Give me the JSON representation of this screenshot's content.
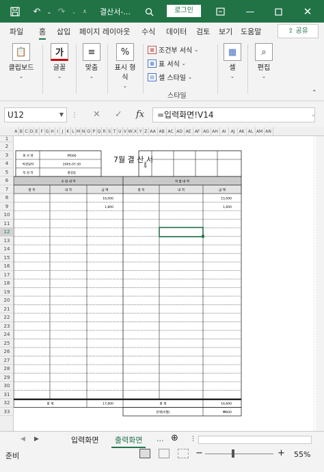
{
  "window": {
    "title": "결산서-...",
    "login_label": "로그인"
  },
  "ribbon_tabs": [
    "파일",
    "홈",
    "삽입",
    "페이지 레이아웃",
    "수식",
    "데이터",
    "검토",
    "보기",
    "도움말"
  ],
  "share_label": "공유",
  "ribbon": {
    "clipboard": "클립보드",
    "font": "글꼴",
    "align": "맞춤",
    "number_line1": "표시 형",
    "number_line2": "식",
    "conditional": "조건부 서식",
    "table_format": "표 서식",
    "cell_style": "셀 스타일",
    "style_group": "스타일",
    "cells": "셀",
    "editing": "편집"
  },
  "formula": {
    "cell_ref": "U12",
    "fx": "fx",
    "value": "=입력화면!V14"
  },
  "columns": [
    "A",
    "B",
    "C",
    "D",
    "E",
    "F",
    "G",
    "H",
    "I",
    "J",
    "K",
    "L",
    "M",
    "N",
    "O",
    "P",
    "Q",
    "R",
    "S",
    "T",
    "U",
    "V",
    "W",
    "X",
    "Y",
    "Z",
    "AA",
    "AB",
    "AC",
    "AD",
    "AE",
    "AF",
    "AG",
    "AH",
    "AI",
    "AJ",
    "AK",
    "AL",
    "AM",
    "AN"
  ],
  "rows": [
    "1",
    "2",
    "3",
    "4",
    "5",
    "6",
    "7",
    "8",
    "9",
    "10",
    "11",
    "12",
    "13",
    "14",
    "15",
    "16",
    "17",
    "18",
    "19",
    "20",
    "21",
    "22",
    "23",
    "24",
    "25",
    "26",
    "27",
    "28",
    "29",
    "30",
    "31",
    "32",
    "33"
  ],
  "report": {
    "title": "7월   결 산 서",
    "company_label": "회 사 명",
    "company_value": "㈜000",
    "date_label": "작성일자",
    "date_value": "2005-07-30",
    "author_label": "작 성 자",
    "author_value": "홍길동",
    "approval_label": "결재",
    "income_header": "수 입 내 역",
    "expense_header": "지 출 내 역",
    "col_item": "항 목",
    "col_detail": "내 역",
    "col_amount": "금 액",
    "income_amounts": [
      "16,000",
      "1,800"
    ],
    "expense_amounts": [
      "15,000",
      "1,600"
    ],
    "total_label": "합 계",
    "income_total": "17,800",
    "expense_total": "16,600",
    "balance_label": "잔액(이월)",
    "balance_value": "₩600"
  },
  "sheets": [
    "입력화면",
    "출력화면"
  ],
  "sheet_more": "...",
  "status": {
    "ready": "준비",
    "zoom": "55%"
  }
}
